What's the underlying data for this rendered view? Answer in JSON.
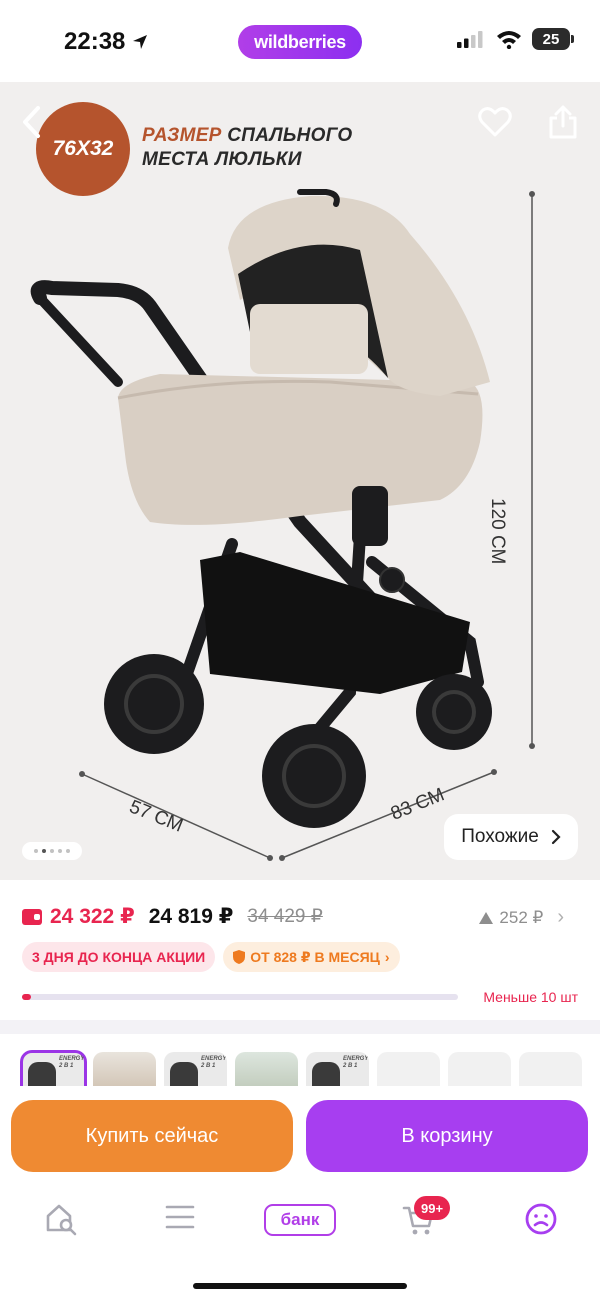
{
  "status_bar": {
    "time": "22:38",
    "brand": "wildberries",
    "battery": "25"
  },
  "gallery": {
    "badge": "76X32",
    "headline_accent": "РАЗМЕР",
    "headline_rest1": "СПАЛЬНОГО",
    "headline_rest2": "МЕСТА ЛЮЛЬКИ",
    "dim_height": "120 СМ",
    "dim_width": "57 СМ",
    "dim_length": "83 СМ",
    "similar_label": "Похожие",
    "slide_current": 2,
    "slide_count": 5,
    "colors": {
      "fabric": "#d9cfc4",
      "frame": "#1c1c1e",
      "badge": "#b5542d"
    }
  },
  "price": {
    "wallet_price": "24 322 ₽",
    "current_price": "24 819 ₽",
    "old_price": "34 429 ₽",
    "price_change": "252 ₽",
    "promo_chip": "3 ДНЯ ДО КОНЦА АКЦИИ",
    "installment_chip": "ОТ 828 ₽ В МЕСЯЦ",
    "stock_text": "Меньше 10 шт",
    "stock_level": 0.02
  },
  "thumbnails": [
    {
      "label": "ENERGY 2 В 1"
    },
    {
      "label": ""
    },
    {
      "label": "ENERGY 2 В 1"
    },
    {
      "label": ""
    },
    {
      "label": "ENERGY 2 В 1"
    },
    {
      "label": ""
    },
    {
      "label": ""
    },
    {
      "label": ""
    }
  ],
  "actions": {
    "buy_now": "Купить сейчас",
    "add_to_cart": "В корзину"
  },
  "nav": {
    "bank_label": "банк",
    "cart_count": "99+"
  },
  "icons": [
    "back-icon",
    "heart-icon",
    "share-icon",
    "location-arrow-icon",
    "signal-icon",
    "wifi-icon",
    "trend-up-icon",
    "shield-icon",
    "home-search-icon",
    "menu-icon",
    "cart-icon",
    "profile-icon"
  ],
  "accent_colors": {
    "wildberries": "#a73ef0",
    "buy": "#ef8a32",
    "sale": "#e8254f"
  }
}
